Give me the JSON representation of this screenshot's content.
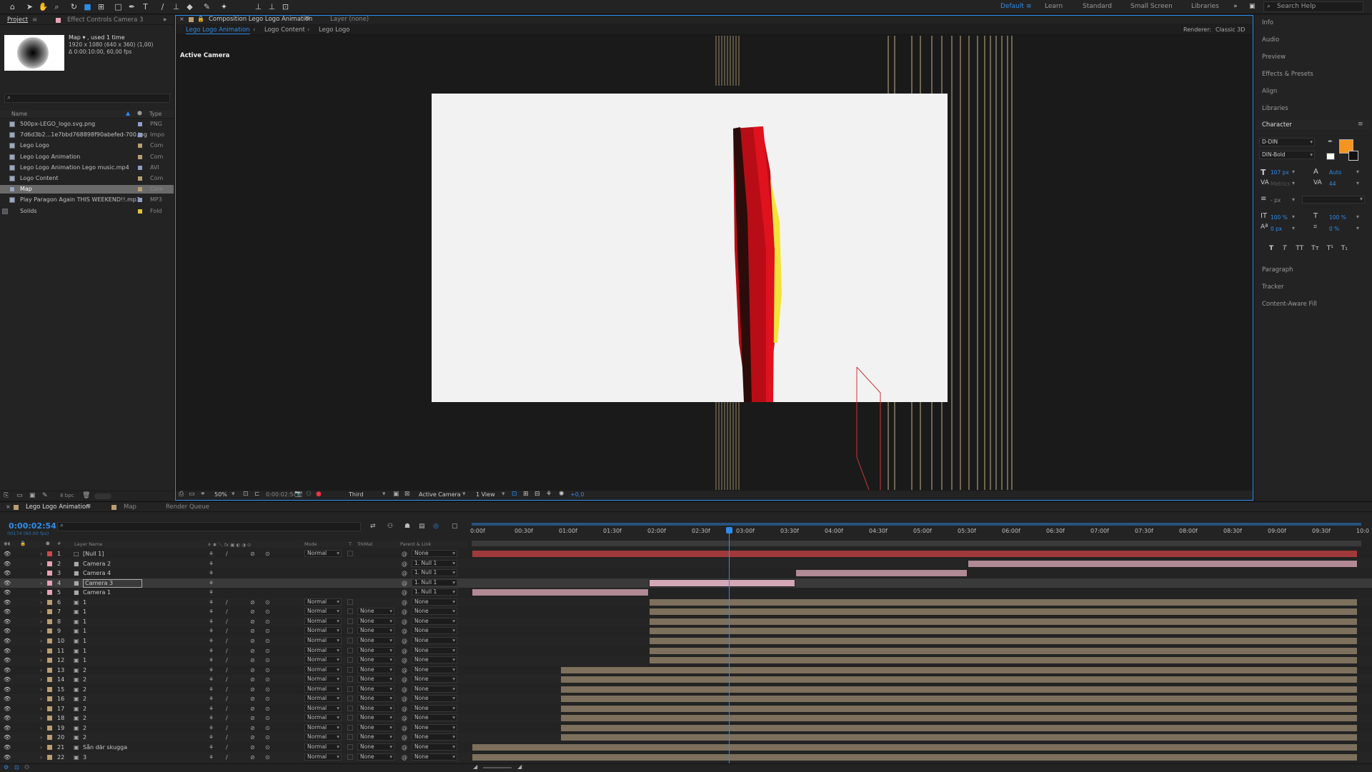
{
  "toolbar": {
    "workspaces": [
      "Default",
      "Learn",
      "Standard",
      "Small Screen",
      "Libraries"
    ],
    "active_workspace": "Default",
    "search_placeholder": "Search Help"
  },
  "project": {
    "tabs": [
      "Project",
      "Effect Controls Camera 3"
    ],
    "selected_name": "Map",
    "selected_meta1": ", used 1 time",
    "selected_meta2": "1920 x 1080  (640 x 360) (1,00)",
    "selected_meta3": "Δ 0:00:10:00, 60,00 fps",
    "col_name": "Name",
    "col_type": "Type",
    "items": [
      {
        "name": "500px-LEGO_logo.svg.png",
        "type": "PNG",
        "color": "#8f9fc8"
      },
      {
        "name": "7d6d3b2...1e7bbd768898f90abefed-700.jpg",
        "type": "Impo",
        "color": "#8f9fc8"
      },
      {
        "name": "Lego Logo",
        "type": "Com",
        "color": "#b89e73"
      },
      {
        "name": "Lego Logo Animation",
        "type": "Com",
        "color": "#b89e73"
      },
      {
        "name": "Lego Logo Animation Lego music.mp4",
        "type": "AVI",
        "color": "#8f9fc8"
      },
      {
        "name": "Logo Content",
        "type": "Com",
        "color": "#b89e73"
      },
      {
        "name": "Map",
        "type": "Com",
        "color": "#b89e73"
      },
      {
        "name": "Play Paragon Again THIS WEEKEND!!.mp3",
        "type": "MP3",
        "color": "#8f9fc8"
      },
      {
        "name": "Solids",
        "type": "Fold",
        "color": "#e3c23e"
      }
    ],
    "bpc": "8 bpc"
  },
  "composition": {
    "tab_label": "Composition Lego Logo Animation",
    "layer_tab": "Layer  (none)",
    "breadcrumbs": [
      "Lego Logo Animation",
      "Logo Content",
      "Lego Logo"
    ],
    "renderer_label": "Renderer:",
    "renderer_value": "Classic 3D",
    "active_camera_label": "Active Camera",
    "zoom": "50%",
    "timecode": "0:00:02:54",
    "resolution": "Third",
    "camera_view": "Active Camera",
    "views": "1 View",
    "exposure": "+0,0"
  },
  "right_panel": {
    "items_top": [
      "Info",
      "Audio",
      "Preview",
      "Effects & Presets",
      "Align",
      "Libraries"
    ],
    "character_title": "Character",
    "font_family": "D-DIN",
    "font_style": "DIN-Bold",
    "font_size": "107 px",
    "leading": "Auto",
    "kerning": "Metrics",
    "tracking": "44",
    "stroke": "- px",
    "vscale": "100 %",
    "hscale": "100 %",
    "baseline": "0 px",
    "tsume": "0 %",
    "fill_color": "#f7941d",
    "items_bottom": [
      "Paragraph",
      "Tracker",
      "Content-Aware Fill"
    ]
  },
  "timeline": {
    "tabs": [
      "Lego Logo Animation",
      "Map",
      "Render Queue"
    ],
    "current_time": "0:00:02:54",
    "frame_info": "00174 (60.00 fps)",
    "headers": {
      "layer_name": "Layer Name",
      "mode": "Mode",
      "t": "T",
      "trkmat": "TrkMat",
      "parent": "Parent & Link"
    },
    "ruler_labels": [
      "0:00f",
      "00:30f",
      "01:00f",
      "01:30f",
      "02:00f",
      "02:30f",
      "03:00f",
      "03:30f",
      "04:00f",
      "04:30f",
      "05:00f",
      "05:30f",
      "06:00f",
      "06:30f",
      "07:00f",
      "07:30f",
      "08:00f",
      "08:30f",
      "09:00f",
      "09:30f",
      "10:0"
    ],
    "duration_seconds": 10,
    "current_seconds": 2.9,
    "layers": [
      {
        "num": "1",
        "name": "[Null 1]",
        "mode": "Normal",
        "trkmat": "",
        "parent": "None",
        "color": "#c94a4a",
        "bar_color": "#a03a3a",
        "start": 0,
        "end": 10,
        "kind": "null"
      },
      {
        "num": "2",
        "name": "Camera 2",
        "mode": "",
        "trkmat": "",
        "parent": "1. Null 1",
        "color": "#e6a3b5",
        "bar_color": "#b08a95",
        "start": 5.6,
        "end": 10,
        "kind": "camera"
      },
      {
        "num": "3",
        "name": "Camera 4",
        "mode": "",
        "trkmat": "",
        "parent": "1. Null 1",
        "color": "#e6a3b5",
        "bar_color": "#b08a95",
        "start": 3.65,
        "end": 5.6,
        "kind": "camera"
      },
      {
        "num": "4",
        "name": "Camera 3",
        "mode": "",
        "trkmat": "",
        "parent": "1. Null 1",
        "color": "#e6a3b5",
        "bar_color": "#d4a7b7",
        "start": 2.0,
        "end": 3.65,
        "kind": "camera"
      },
      {
        "num": "5",
        "name": "Camera 1",
        "mode": "",
        "trkmat": "",
        "parent": "1. Null 1",
        "color": "#e6a3b5",
        "bar_color": "#b08a95",
        "start": 0,
        "end": 2.0,
        "kind": "camera"
      },
      {
        "num": "6",
        "name": "1",
        "mode": "Normal",
        "trkmat": "",
        "parent": "None",
        "color": "#b89e73",
        "bar_color": "#7d705c",
        "start": 2.0,
        "end": 10,
        "kind": "comp"
      },
      {
        "num": "7",
        "name": "1",
        "mode": "Normal",
        "trkmat": "None",
        "parent": "None",
        "color": "#b89e73",
        "bar_color": "#7d705c",
        "start": 2.0,
        "end": 10,
        "kind": "comp"
      },
      {
        "num": "8",
        "name": "1",
        "mode": "Normal",
        "trkmat": "None",
        "parent": "None",
        "color": "#b89e73",
        "bar_color": "#7d705c",
        "start": 2.0,
        "end": 10,
        "kind": "comp"
      },
      {
        "num": "9",
        "name": "1",
        "mode": "Normal",
        "trkmat": "None",
        "parent": "None",
        "color": "#b89e73",
        "bar_color": "#7d705c",
        "start": 2.0,
        "end": 10,
        "kind": "comp"
      },
      {
        "num": "10",
        "name": "1",
        "mode": "Normal",
        "trkmat": "None",
        "parent": "None",
        "color": "#b89e73",
        "bar_color": "#7d705c",
        "start": 2.0,
        "end": 10,
        "kind": "comp"
      },
      {
        "num": "11",
        "name": "1",
        "mode": "Normal",
        "trkmat": "None",
        "parent": "None",
        "color": "#b89e73",
        "bar_color": "#7d705c",
        "start": 2.0,
        "end": 10,
        "kind": "comp"
      },
      {
        "num": "12",
        "name": "1",
        "mode": "Normal",
        "trkmat": "None",
        "parent": "None",
        "color": "#b89e73",
        "bar_color": "#7d705c",
        "start": 2.0,
        "end": 10,
        "kind": "comp"
      },
      {
        "num": "13",
        "name": "2",
        "mode": "Normal",
        "trkmat": "None",
        "parent": "None",
        "color": "#b89e73",
        "bar_color": "#7d705c",
        "start": 1.0,
        "end": 10,
        "kind": "comp"
      },
      {
        "num": "14",
        "name": "2",
        "mode": "Normal",
        "trkmat": "None",
        "parent": "None",
        "color": "#b89e73",
        "bar_color": "#7d705c",
        "start": 1.0,
        "end": 10,
        "kind": "comp"
      },
      {
        "num": "15",
        "name": "2",
        "mode": "Normal",
        "trkmat": "None",
        "parent": "None",
        "color": "#b89e73",
        "bar_color": "#7d705c",
        "start": 1.0,
        "end": 10,
        "kind": "comp"
      },
      {
        "num": "16",
        "name": "2",
        "mode": "Normal",
        "trkmat": "None",
        "parent": "None",
        "color": "#b89e73",
        "bar_color": "#7d705c",
        "start": 1.0,
        "end": 10,
        "kind": "comp"
      },
      {
        "num": "17",
        "name": "2",
        "mode": "Normal",
        "trkmat": "None",
        "parent": "None",
        "color": "#b89e73",
        "bar_color": "#7d705c",
        "start": 1.0,
        "end": 10,
        "kind": "comp"
      },
      {
        "num": "18",
        "name": "2",
        "mode": "Normal",
        "trkmat": "None",
        "parent": "None",
        "color": "#b89e73",
        "bar_color": "#7d705c",
        "start": 1.0,
        "end": 10,
        "kind": "comp"
      },
      {
        "num": "19",
        "name": "2",
        "mode": "Normal",
        "trkmat": "None",
        "parent": "None",
        "color": "#b89e73",
        "bar_color": "#7d705c",
        "start": 1.0,
        "end": 10,
        "kind": "comp"
      },
      {
        "num": "20",
        "name": "2",
        "mode": "Normal",
        "trkmat": "None",
        "parent": "None",
        "color": "#b89e73",
        "bar_color": "#7d705c",
        "start": 1.0,
        "end": 10,
        "kind": "comp"
      },
      {
        "num": "21",
        "name": "Sån där skugga",
        "mode": "Normal",
        "trkmat": "None",
        "parent": "None",
        "color": "#b89e73",
        "bar_color": "#7d705c",
        "start": 0,
        "end": 10,
        "kind": "comp"
      },
      {
        "num": "22",
        "name": "3",
        "mode": "Normal",
        "trkmat": "None",
        "parent": "None",
        "color": "#b89e73",
        "bar_color": "#7d705c",
        "start": 0,
        "end": 10,
        "kind": "comp"
      }
    ]
  }
}
